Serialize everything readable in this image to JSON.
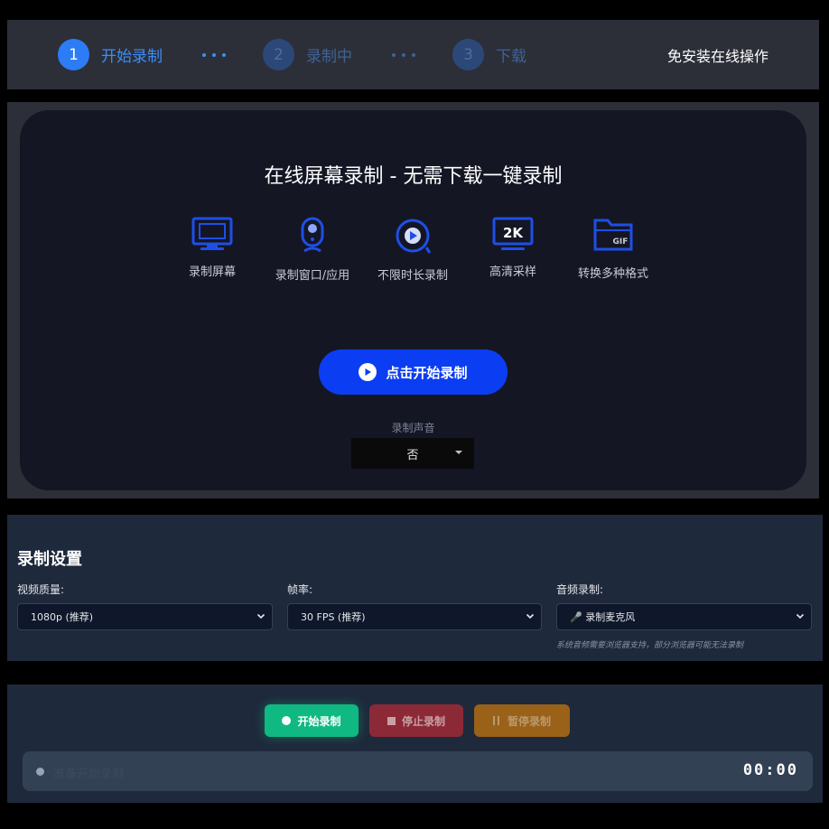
{
  "steps": [
    {
      "num": "1",
      "label": "开始录制"
    },
    {
      "num": "2",
      "label": "录制中"
    },
    {
      "num": "3",
      "label": "下载"
    }
  ],
  "header_right": "免安装在线操作",
  "main": {
    "title": "在线屏幕录制 - 无需下载一键录制",
    "features": [
      {
        "icon": "monitor-icon",
        "label": "录制屏幕"
      },
      {
        "icon": "webcam-icon",
        "label": "录制窗口/应用"
      },
      {
        "icon": "play-circle-icon",
        "label": "不限时长录制"
      },
      {
        "icon": "2k-icon",
        "label": "高清采样",
        "badge": "2K"
      },
      {
        "icon": "folder-gif-icon",
        "label": "转换多种格式",
        "badge": "GIF"
      }
    ],
    "record_button": "点击开始录制",
    "sound_label": "录制声音",
    "sound_value": "否"
  },
  "settings": {
    "title": "录制设置",
    "video_quality": {
      "label": "视频质量:",
      "value": "1080p (推荐)"
    },
    "frame_rate": {
      "label": "帧率:",
      "value": "30 FPS (推荐)"
    },
    "audio": {
      "label": "音频录制:",
      "value": "🎤 录制麦克风"
    },
    "hint": "系统音频需要浏览器支持，部分浏览器可能无法录制"
  },
  "controls": {
    "start": "开始录制",
    "stop": "停止录制",
    "pause": "暂停录制",
    "status": "准备开始录制",
    "timer": "00:00"
  },
  "colors": {
    "accent": "#2d7cf6",
    "primary_button": "#0b3df2",
    "start": "#10b981",
    "stop": "#8b2a36",
    "pause": "#9a6118"
  }
}
